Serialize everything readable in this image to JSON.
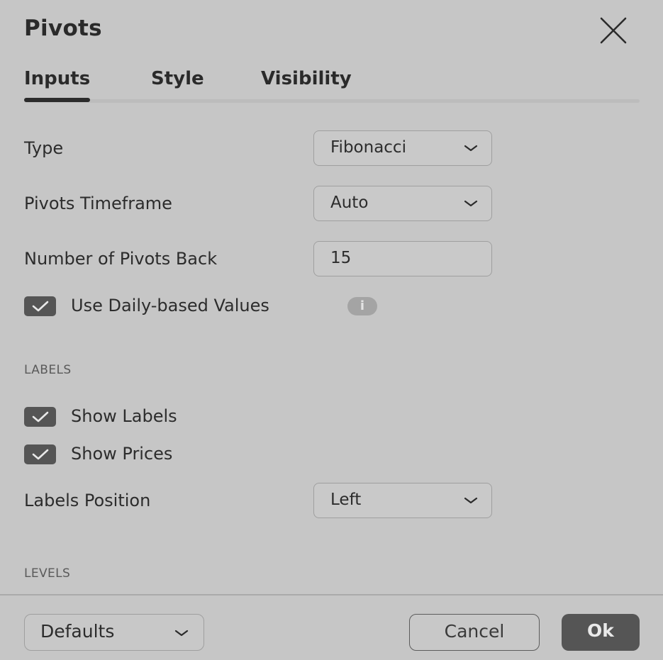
{
  "dialog": {
    "title": "Pivots"
  },
  "tabs": [
    {
      "label": "Inputs",
      "active": true
    },
    {
      "label": "Style",
      "active": false
    },
    {
      "label": "Visibility",
      "active": false
    }
  ],
  "inputs": {
    "type": {
      "label": "Type",
      "value": "Fibonacci"
    },
    "timeframe": {
      "label": "Pivots Timeframe",
      "value": "Auto"
    },
    "pivots_back": {
      "label": "Number of Pivots Back",
      "value": "15"
    },
    "daily_values": {
      "label": "Use Daily-based Values",
      "checked": true,
      "info_icon": "i"
    }
  },
  "labels_section": {
    "heading": "LABELS",
    "show_labels": {
      "label": "Show Labels",
      "checked": true
    },
    "show_prices": {
      "label": "Show Prices",
      "checked": true
    },
    "position": {
      "label": "Labels Position",
      "value": "Left"
    }
  },
  "levels_section": {
    "heading": "LEVELS"
  },
  "footer": {
    "defaults_label": "Defaults",
    "cancel_label": "Cancel",
    "ok_label": "Ok"
  },
  "colors": {
    "background": "#c6c6c6",
    "accent_dark": "#555555",
    "text": "#2b2b2b"
  },
  "icons": {
    "close": "close-icon",
    "chevron": "chevron-down-icon",
    "check": "check-icon",
    "info": "info-icon"
  }
}
